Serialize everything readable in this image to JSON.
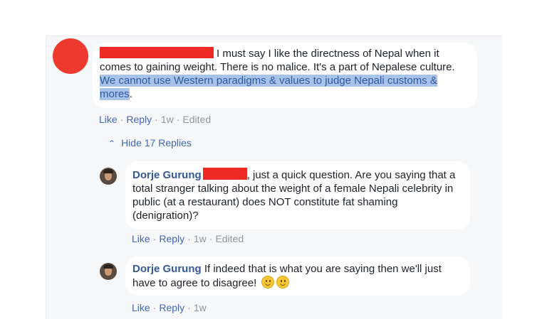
{
  "comment": {
    "text_before_highlight": "I must say I like the directness of Nepal when it comes to gaining weight. There is no malice. It's a part of Nepalese culture.",
    "highlighted_text": "We cannot use Western paradigms & values to judge Nepali customs & mores",
    "text_after_highlight": ".",
    "actions": {
      "like": "Like",
      "reply": "Reply",
      "time": "1w",
      "edited": "Edited",
      "dot": "·"
    }
  },
  "hide_replies_label": "Hide 17 Replies",
  "replies": [
    {
      "author": "Dorje Gurung",
      "text": ", just a quick question. Are you saying that a total stranger talking about the weight of a female Nepali celebrity in public (at a restaurant) does NOT constitute fat shaming (denigration)?",
      "actions": {
        "like": "Like",
        "reply": "Reply",
        "time": "1w",
        "edited": "Edited",
        "dot": "·"
      }
    },
    {
      "author": "Dorje Gurung",
      "text": "If indeed that is what you are saying then we'll just have to agree to disagree!",
      "actions": {
        "like": "Like",
        "reply": "Reply",
        "time": "1w",
        "dot": "·"
      }
    }
  ],
  "colors": {
    "redaction": "#ee2a24",
    "link": "#4267b2",
    "name": "#365899",
    "highlight": "#a9c3e8"
  }
}
